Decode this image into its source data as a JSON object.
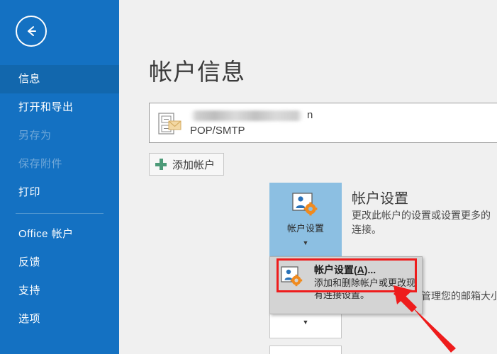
{
  "sidebar": {
    "back_button": {
      "icon": "back-arrow-icon",
      "label": ""
    },
    "items": [
      {
        "label": "信息",
        "state": "selected"
      },
      {
        "label": "打开和导出",
        "state": "normal"
      },
      {
        "label": "另存为",
        "state": "disabled"
      },
      {
        "label": "保存附件",
        "state": "disabled"
      },
      {
        "label": "打印",
        "state": "normal"
      },
      {
        "label": "Office 帐户",
        "state": "normal"
      },
      {
        "label": "反馈",
        "state": "normal"
      },
      {
        "label": "支持",
        "state": "normal"
      },
      {
        "label": "选项",
        "state": "normal"
      }
    ],
    "background_color": "#1471c2",
    "selected_color": "#1267ad"
  },
  "main": {
    "page_title": "帐户信息",
    "account": {
      "email_visible_tail": "n",
      "account_type": "POP/SMTP",
      "icon": "mail-account-icon"
    },
    "add_account_button": {
      "label": "添加帐户",
      "icon": "plus-icon",
      "icon_color": "#4c9a78"
    },
    "account_settings_tile": {
      "label": "帐户设置",
      "icon": "account-settings-icon",
      "caret": "▼",
      "background_color": "#8cbfe2"
    },
    "account_settings_section": {
      "heading": "帐户设置",
      "description": "更改此帐户的设置或设置更多的连接。"
    },
    "mailbox_section": {
      "description": "项目并存档，来管理您的邮箱大小。"
    },
    "tools_tile": {
      "caret": "▼",
      "icon": "tools-icon"
    }
  },
  "dropdown": {
    "background_color": "#d4d4d4",
    "items": [
      {
        "title_prefix": "帐户设置(",
        "title_accel": "A",
        "title_suffix": ")...",
        "description": "添加和删除帐户或更改现有连接设置。",
        "icon": "account-settings-icon",
        "highlighted": true
      }
    ]
  },
  "annotations": {
    "highlight_box_color": "#ee1c1c",
    "arrow_color": "#ee1c1c",
    "arrow_name": "red-pointer-arrow"
  }
}
